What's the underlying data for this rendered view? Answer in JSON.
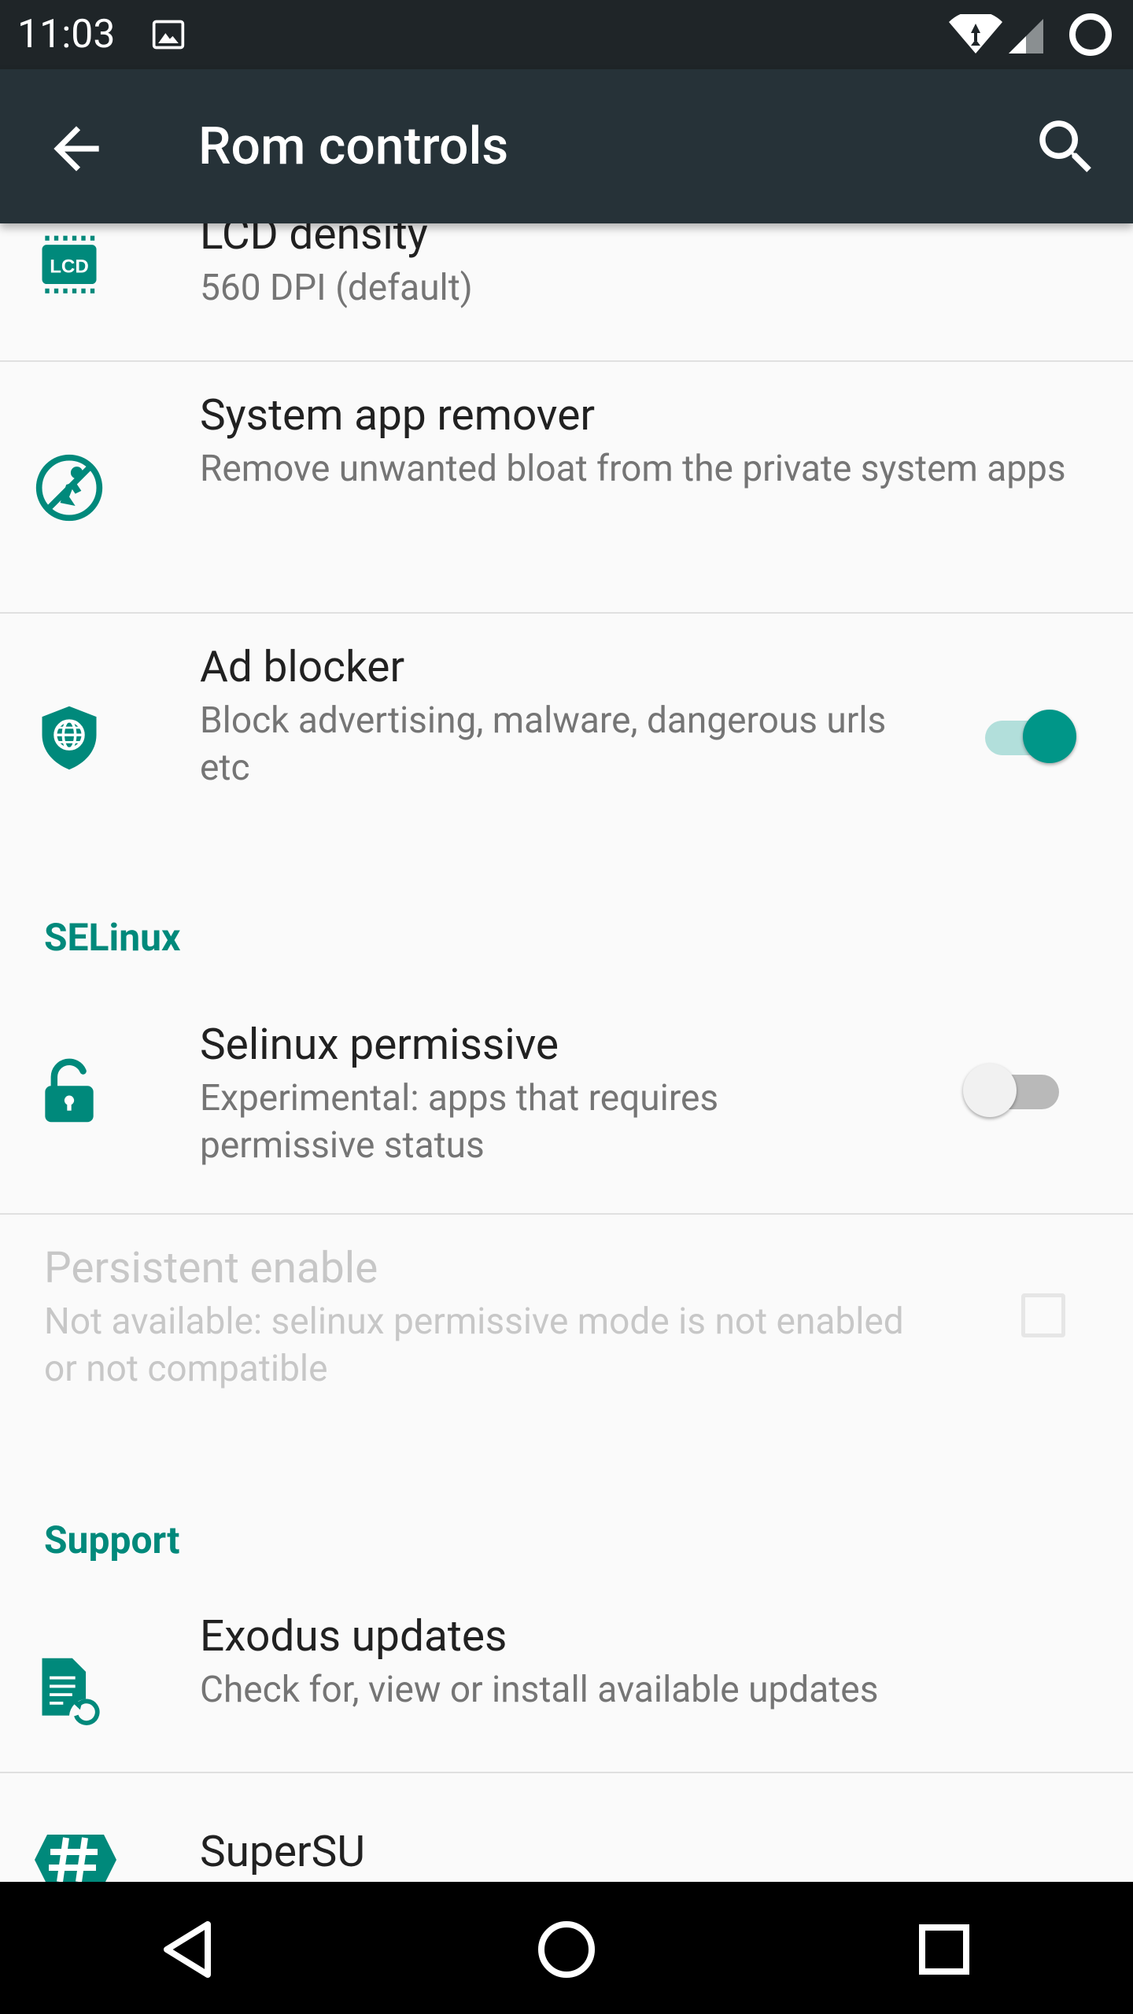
{
  "status_bar": {
    "time": "11:03",
    "icons": [
      "image-notification-icon",
      "wifi-icon",
      "signal-icon",
      "battery-icon"
    ]
  },
  "toolbar": {
    "title": "Rom controls",
    "back_icon": "arrow-back-icon",
    "search_icon": "search-icon"
  },
  "preferences": [
    {
      "title": "LCD density",
      "summary": "560 DPI (default)",
      "icon": "lcd-icon",
      "control": "none"
    },
    {
      "title": "System app remover",
      "summary": "Remove unwanted bloat from the private system apps",
      "icon": "app-remover-icon",
      "control": "none"
    },
    {
      "title": "Ad blocker",
      "summary": "Block advertising, malware, dangerous urls etc",
      "icon": "shield-globe-icon",
      "control": "switch",
      "checked": true
    }
  ],
  "selinux_section": {
    "header": "SELinux",
    "items": [
      {
        "title": "Selinux permissive",
        "summary": "Experimental: apps that requires permissive status",
        "icon": "unlock-icon",
        "control": "switch",
        "checked": false
      },
      {
        "title": "Persistent enable",
        "summary": "Not available: selinux permissive mode is not enabled or not compatible",
        "control": "checkbox",
        "checked": false,
        "enabled": false
      }
    ]
  },
  "support_section": {
    "header": "Support",
    "items": [
      {
        "title": "Exodus updates",
        "summary": "Check for, view or install available updates",
        "icon": "update-document-icon"
      },
      {
        "title": "SuperSU",
        "icon": "supersu-hash-icon"
      }
    ]
  },
  "colors": {
    "accent": "#009688",
    "accent_dark": "#00897b",
    "toolbar": "#263238",
    "status_bar": "#1f2528"
  },
  "nav_bar": {
    "icons": [
      "back-triangle-icon",
      "home-circle-icon",
      "recents-square-icon"
    ]
  }
}
